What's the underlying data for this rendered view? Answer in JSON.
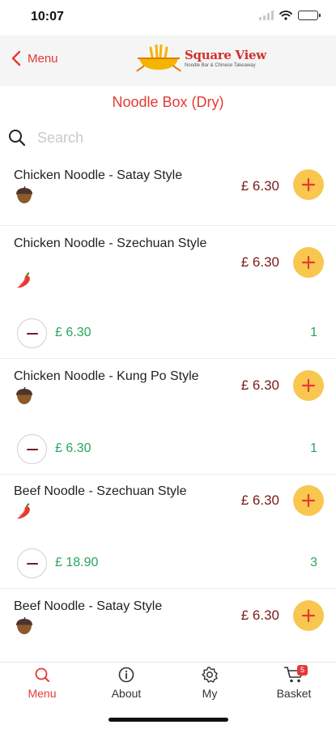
{
  "status_bar": {
    "time": "10:07"
  },
  "nav": {
    "back_label": "Menu",
    "logo_title": "Square View",
    "logo_subtitle": "Noodle Bar & Chinese Takeaway"
  },
  "section_title": "Noodle Box (Dry)",
  "search": {
    "placeholder": "Search",
    "value": ""
  },
  "items": [
    {
      "name": "Chicken Noodle - Satay Style",
      "icon": "nut-icon",
      "price": "£ 6.30"
    },
    {
      "name": "Chicken Noodle - Szechuan Style",
      "icon": "chili-icon",
      "price": "£ 6.30",
      "selected_price": "£ 6.30",
      "quantity": "1"
    },
    {
      "name": "Chicken Noodle - Kung Po Style",
      "icon": "nut-icon",
      "price": "£ 6.30",
      "selected_price": "£ 6.30",
      "quantity": "1"
    },
    {
      "name": "Beef Noodle - Szechuan Style",
      "icon": "chili-icon",
      "price": "£ 6.30",
      "selected_price": "£ 18.90",
      "quantity": "3"
    },
    {
      "name": "Beef Noodle - Satay Style",
      "icon": "nut-icon",
      "price": "£ 6.30"
    }
  ],
  "tabs": [
    {
      "label": "Menu",
      "icon": "search-icon",
      "active": true
    },
    {
      "label": "About",
      "icon": "info-icon",
      "active": false
    },
    {
      "label": "My",
      "icon": "gear-icon",
      "active": false
    },
    {
      "label": "Basket",
      "icon": "cart-icon",
      "active": false,
      "badge": "5"
    }
  ],
  "colors": {
    "accent": "#e53935",
    "price": "#7a1a1a",
    "add_button": "#f9c74f",
    "quantity_green": "#26a65b"
  }
}
